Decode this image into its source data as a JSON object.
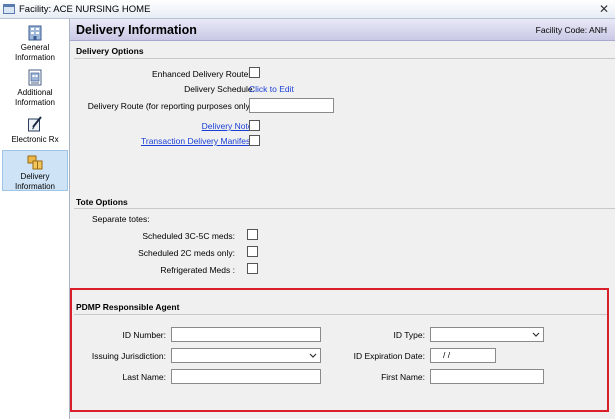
{
  "window": {
    "title": "Facility: ACE NURSING HOME",
    "close_glyph": "✕"
  },
  "sidebar": {
    "items": [
      {
        "line1": "General",
        "line2": "Information",
        "icon": "building-icon"
      },
      {
        "line1": "Additional",
        "line2": "Information",
        "icon": "document-building-icon"
      },
      {
        "line1": "Electronic Rx",
        "line2": "",
        "icon": "pen-pad-icon"
      },
      {
        "line1": "Delivery",
        "line2": "Information",
        "icon": "delivery-boxes-icon",
        "selected": true
      }
    ]
  },
  "header": {
    "title": "Delivery Information",
    "facility_code_label": "Facility Code:",
    "facility_code": "ANH"
  },
  "delivery_options": {
    "title": "Delivery Options",
    "enhanced_routes_label": "Enhanced Delivery Routes:",
    "schedule_label": "Delivery Schedule:",
    "schedule_link": "Click to Edit",
    "route_label": "Delivery Route (for reporting purposes only):",
    "route_value": "",
    "note_link": "Delivery Note:",
    "manifest_link": "Transaction Delivery Manifest:"
  },
  "tote_options": {
    "title": "Tote Options",
    "separate_label": "Separate totes:",
    "sched_3c5c_label": "Scheduled 3C-5C meds:",
    "sched_2c_label": "Scheduled 2C meds only:",
    "refrigerated_label": "Refrigerated Meds :"
  },
  "pdmp": {
    "title": "PDMP Responsible Agent",
    "id_number_label": "ID Number:",
    "id_number_value": "",
    "id_type_label": "ID Type:",
    "id_type_value": "",
    "issuing_label": "Issuing Jurisdiction:",
    "issuing_value": "",
    "expiration_label": "ID Expiration Date:",
    "expiration_value": "/     /",
    "last_name_label": "Last Name:",
    "last_name_value": "",
    "first_name_label": "First Name:",
    "first_name_value": ""
  }
}
